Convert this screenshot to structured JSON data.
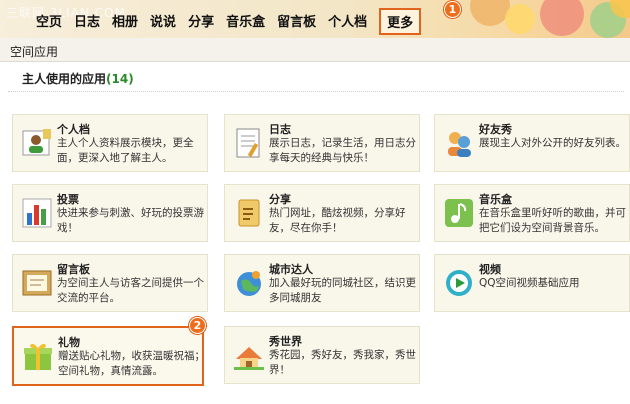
{
  "watermark": "三联网 3LIAN.COM",
  "nav": {
    "items": [
      "空页",
      "日志",
      "相册",
      "说说",
      "分享",
      "音乐盒",
      "留言板",
      "个人档"
    ],
    "more_label": "更多"
  },
  "badges": [
    "1",
    "2"
  ],
  "section": {
    "title": "空间应用",
    "subtitle": "主人使用的应用",
    "count": "(14)"
  },
  "apps": [
    {
      "name": "个人档",
      "desc": "主人个人资料展示模块，更全面，更深入地了解主人。",
      "icon": "profile-icon"
    },
    {
      "name": "日志",
      "desc": "展示日志，记录生活，用日志分享每天的经典与快乐！",
      "icon": "blog-icon"
    },
    {
      "name": "好友秀",
      "desc": "展现主人对外公开的好友列表。",
      "icon": "friends-icon"
    },
    {
      "name": "投票",
      "desc": "快进来参与刺激、好玩的投票游戏！",
      "icon": "vote-icon"
    },
    {
      "name": "分享",
      "desc": "热门网址，酷炫视频，分享好友，尽在你手！",
      "icon": "share-icon"
    },
    {
      "name": "音乐盒",
      "desc": "在音乐盒里听好听的歌曲，并可把它们设为空间背景音乐。",
      "icon": "music-icon"
    },
    {
      "name": "留言板",
      "desc": "为空间主人与访客之间提供一个交流的平台。",
      "icon": "guestbook-icon"
    },
    {
      "name": "城市达人",
      "desc": "加入最好玩的同城社区，结识更多同城朋友",
      "icon": "city-icon"
    },
    {
      "name": "视频",
      "desc": "QQ空间视频基础应用",
      "icon": "video-icon"
    },
    {
      "name": "礼物",
      "desc": "赠送贴心礼物，收获温暖祝福；空间礼物，真情流露。",
      "icon": "gift-icon"
    },
    {
      "name": "秀世界",
      "desc": "秀花园，秀好友，秀我家，秀世界！",
      "icon": "world-icon"
    }
  ]
}
